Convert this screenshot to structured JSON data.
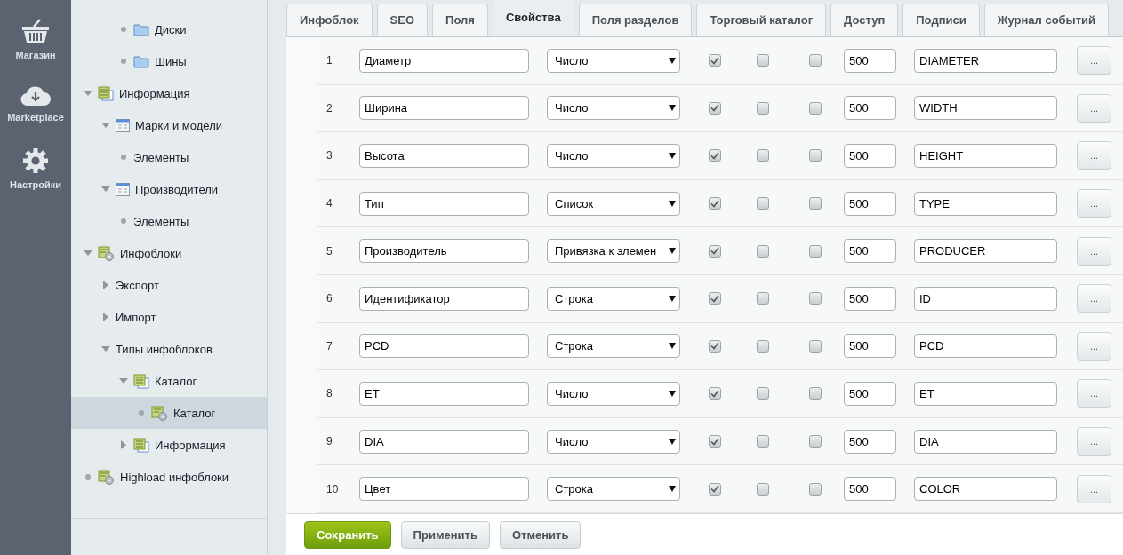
{
  "left_menu": [
    {
      "label": "Магазин",
      "kind": "basket"
    },
    {
      "label": "Marketplace",
      "kind": "cloud"
    },
    {
      "label": "Настройки",
      "kind": "gear"
    }
  ],
  "tree_partial_branch": {
    "children": [
      {
        "label": "Диски",
        "kind": "folder",
        "selected": false
      },
      {
        "label": "Шины",
        "kind": "folder",
        "selected": false
      }
    ]
  },
  "tree": [
    {
      "label": "Информация",
      "kind": "stack",
      "expanded": true,
      "selected": false,
      "children": [
        {
          "label": "Марки и модели",
          "kind": "form",
          "expanded": true,
          "selected": false,
          "children": [
            {
              "label": "Элементы",
              "kind": "plain",
              "selected": false
            }
          ]
        },
        {
          "label": "Производители",
          "kind": "form",
          "expanded": true,
          "selected": false,
          "children": [
            {
              "label": "Элементы",
              "kind": "plain",
              "selected": false
            }
          ]
        }
      ]
    },
    {
      "label": "Инфоблоки",
      "kind": "stackgear",
      "expanded": true,
      "selected": false,
      "children": [
        {
          "label": "Экспорт",
          "kind": "plain",
          "expanded": false,
          "selected": false
        },
        {
          "label": "Импорт",
          "kind": "plain",
          "expanded": false,
          "selected": false
        },
        {
          "label": "Типы инфоблоков",
          "kind": "plain",
          "expanded": true,
          "selected": false,
          "children": [
            {
              "label": "Каталог",
              "kind": "stack",
              "expanded": true,
              "selected": false,
              "children": [
                {
                  "label": "Каталог",
                  "kind": "stackgear",
                  "selected": true
                }
              ]
            },
            {
              "label": "Информация",
              "kind": "stack",
              "expanded": false,
              "selected": false
            }
          ]
        }
      ]
    },
    {
      "label": "Highload инфоблоки",
      "kind": "stackgear",
      "selected": false
    }
  ],
  "tabs": [
    {
      "label": "Инфоблок",
      "selected": false
    },
    {
      "label": "SEO",
      "selected": false
    },
    {
      "label": "Поля",
      "selected": false
    },
    {
      "label": "Свойства",
      "selected": true
    },
    {
      "label": "Поля разделов",
      "selected": false
    },
    {
      "label": "Торговый каталог",
      "selected": false
    },
    {
      "label": "Доступ",
      "selected": false
    },
    {
      "label": "Подписи",
      "selected": false
    },
    {
      "label": "Журнал событий",
      "selected": false
    }
  ],
  "properties": [
    {
      "number": "1",
      "name": "Диаметр",
      "type": "Число",
      "active": true,
      "multiple": false,
      "required": false,
      "sort": "500",
      "code": "DIAMETER",
      "more": "..."
    },
    {
      "number": "2",
      "name": "Ширина",
      "type": "Число",
      "active": true,
      "multiple": false,
      "required": false,
      "sort": "500",
      "code": "WIDTH",
      "more": "..."
    },
    {
      "number": "3",
      "name": "Высота",
      "type": "Число",
      "active": true,
      "multiple": false,
      "required": false,
      "sort": "500",
      "code": "HEIGHT",
      "more": "..."
    },
    {
      "number": "4",
      "name": "Тип",
      "type": "Список",
      "active": true,
      "multiple": false,
      "required": false,
      "sort": "500",
      "code": "TYPE",
      "more": "..."
    },
    {
      "number": "5",
      "name": "Производитель",
      "type": "Привязка к элемен",
      "active": true,
      "multiple": false,
      "required": false,
      "sort": "500",
      "code": "PRODUCER",
      "more": "..."
    },
    {
      "number": "6",
      "name": "Идентификатор",
      "type": "Строка",
      "active": true,
      "multiple": false,
      "required": false,
      "sort": "500",
      "code": "ID",
      "more": "..."
    },
    {
      "number": "7",
      "name": "PCD",
      "type": "Строка",
      "active": true,
      "multiple": false,
      "required": false,
      "sort": "500",
      "code": "PCD",
      "more": "..."
    },
    {
      "number": "8",
      "name": "ET",
      "type": "Число",
      "active": true,
      "multiple": false,
      "required": false,
      "sort": "500",
      "code": "ET",
      "more": "..."
    },
    {
      "number": "9",
      "name": "DIA",
      "type": "Число",
      "active": true,
      "multiple": false,
      "required": false,
      "sort": "500",
      "code": "DIA",
      "more": "..."
    },
    {
      "number": "10",
      "name": "Цвет",
      "type": "Строка",
      "active": true,
      "multiple": false,
      "required": false,
      "sort": "500",
      "code": "COLOR",
      "more": "..."
    }
  ],
  "buttons": [
    {
      "label": "Сохранить",
      "kind": "primary"
    },
    {
      "label": "Применить",
      "kind": "secondary"
    },
    {
      "label": "Отменить",
      "kind": "secondary"
    }
  ]
}
